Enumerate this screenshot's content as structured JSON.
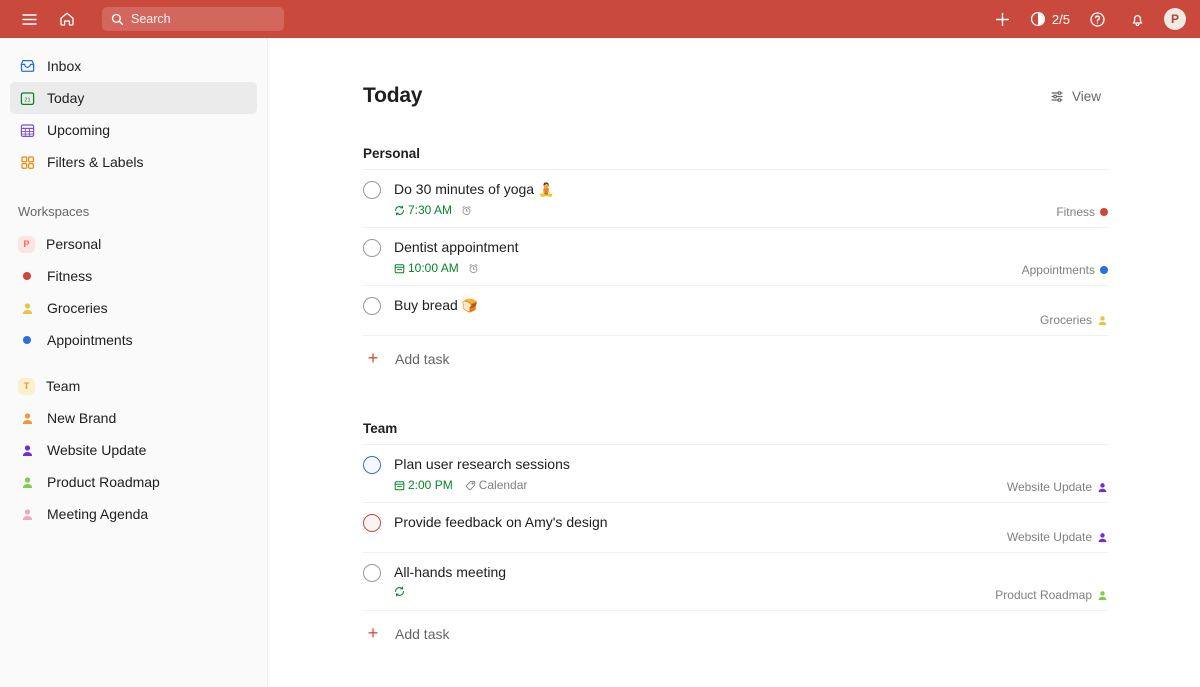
{
  "topbar": {
    "menu_icon": "hamburger-menu-icon",
    "home_icon": "home-icon",
    "search_icon": "search-icon",
    "search_placeholder": "Search",
    "search_value": "",
    "add_icon": "plus-icon",
    "karma_icon": "productivity-circle-icon",
    "karma_count": "2/5",
    "help_icon": "question-mark-icon",
    "notifications_icon": "bell-icon",
    "avatar_initial": "P",
    "background_color": "#c9493d"
  },
  "sidebar": {
    "nav": [
      {
        "label": "Inbox",
        "icon": "inbox-icon",
        "color": "#246fe0",
        "active": false
      },
      {
        "label": "Today",
        "icon": "calendar-today-icon",
        "color": "#058527",
        "active": true
      },
      {
        "label": "Upcoming",
        "icon": "calendar-month-icon",
        "color": "#7b51cf",
        "active": false
      },
      {
        "label": "Filters & Labels",
        "icon": "filters-labels-icon",
        "color": "#eb8909",
        "active": false
      }
    ],
    "workspaces_heading": "Workspaces",
    "workspaces": [
      {
        "label": "Personal",
        "icon": "workspace-badge",
        "badge": "P",
        "color": "#eb6b61",
        "bg": "#fbe4e2"
      },
      {
        "label": "Fitness",
        "icon": "project-dot",
        "color": "#d1453b"
      },
      {
        "label": "Groceries",
        "icon": "shared-project-icon",
        "color": "#eec049"
      },
      {
        "label": "Appointments",
        "icon": "project-dot",
        "color": "#2a6ee0"
      }
    ],
    "team": [
      {
        "label": "Team",
        "icon": "workspace-badge",
        "badge": "T",
        "color": "#d6a020",
        "bg": "#faf0cf"
      },
      {
        "label": "New Brand",
        "icon": "shared-project-icon",
        "color": "#f0953b"
      },
      {
        "label": "Website Update",
        "icon": "shared-project-icon",
        "color": "#7030d0"
      },
      {
        "label": "Product Roadmap",
        "icon": "shared-project-icon",
        "color": "#7ecc49"
      },
      {
        "label": "Meeting Agenda",
        "icon": "shared-project-icon",
        "color": "#f3a5c0"
      }
    ]
  },
  "main": {
    "title": "Today",
    "view_label": "View",
    "view_icon": "sliders-icon",
    "add_task_label": "Add task",
    "groups": [
      {
        "name": "Personal",
        "tasks": [
          {
            "title": "Do 30 minutes of yoga",
            "emoji": "🧘",
            "checkbox_priority": "p4",
            "date_icon": "recurring-icon",
            "date": "7:30 AM",
            "reminder_icon": "alarm-clock-icon",
            "tag": "",
            "project": "Fitness",
            "project_icon": "project-dot",
            "project_color": "#d1453b"
          },
          {
            "title": "Dentist appointment",
            "emoji": "",
            "checkbox_priority": "p4",
            "date_icon": "calendar-icon",
            "date": "10:00 AM",
            "reminder_icon": "alarm-clock-icon",
            "tag": "",
            "project": "Appointments",
            "project_icon": "project-dot",
            "project_color": "#2a6ee0"
          },
          {
            "title": "Buy bread",
            "emoji": "🍞",
            "checkbox_priority": "p4",
            "date_icon": "",
            "date": "",
            "reminder_icon": "",
            "tag": "",
            "project": "Groceries",
            "project_icon": "shared-project-icon",
            "project_color": "#eec049"
          }
        ]
      },
      {
        "name": "Team",
        "tasks": [
          {
            "title": "Plan user research sessions",
            "emoji": "",
            "checkbox_priority": "p2",
            "date_icon": "calendar-icon",
            "date": "2:00 PM",
            "reminder_icon": "",
            "tag": "Calendar",
            "tag_icon": "label-tag-icon",
            "project": "Website Update",
            "project_icon": "shared-project-icon",
            "project_color": "#7030d0"
          },
          {
            "title": "Provide feedback on Amy's design",
            "emoji": "",
            "checkbox_priority": "p1",
            "date_icon": "",
            "date": "",
            "reminder_icon": "",
            "tag": "",
            "project": "Website Update",
            "project_icon": "shared-project-icon",
            "project_color": "#7030d0"
          },
          {
            "title": "All-hands meeting",
            "emoji": "",
            "checkbox_priority": "p4",
            "date_icon": "recurring-icon",
            "date": "",
            "reminder_icon": "",
            "tag": "",
            "project": "Product Roadmap",
            "project_icon": "shared-project-icon",
            "project_color": "#7ecc49"
          }
        ]
      }
    ]
  }
}
